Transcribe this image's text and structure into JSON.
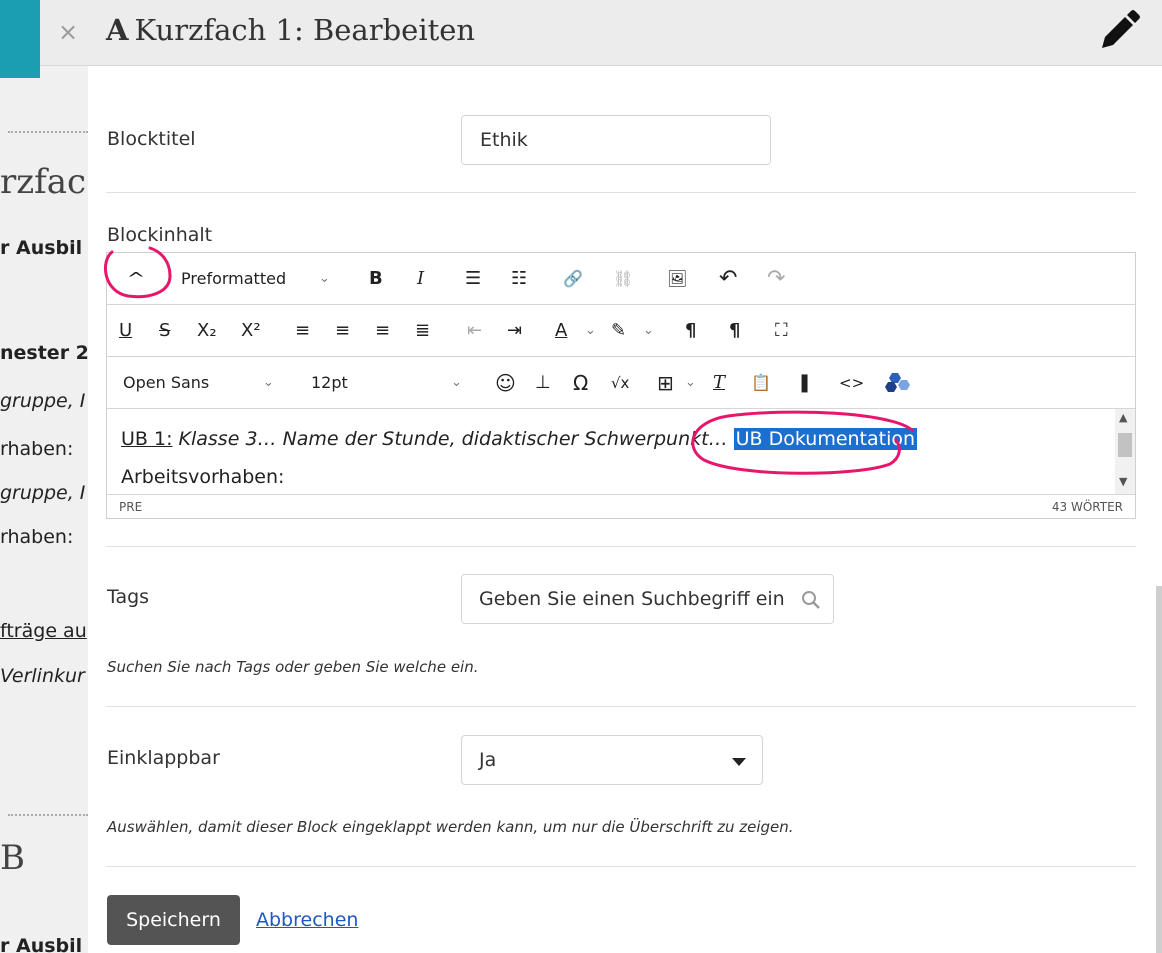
{
  "background": {
    "lines": [
      {
        "text": "rzfac",
        "kind": "big"
      },
      {
        "text": "r Ausbil",
        "kind": "bold"
      },
      {
        "text": "nester 2",
        "kind": "bold"
      },
      {
        "text": "gruppe, I",
        "kind": "italic"
      },
      {
        "text": "rhaben:",
        "kind": "normal"
      },
      {
        "text": "gruppe, I",
        "kind": "italic"
      },
      {
        "text": "rhaben:",
        "kind": "normal"
      },
      {
        "text": "fträge au",
        "kind": "underline"
      },
      {
        "text": "Verlinkur",
        "kind": "italic"
      },
      {
        "text": "B",
        "kind": "big"
      },
      {
        "text": "r Ausbil",
        "kind": "bold"
      }
    ]
  },
  "modal": {
    "close_glyph": "×",
    "title_icon": "A",
    "title": "Kurzfach 1: Bearbeiten"
  },
  "form": {
    "blocktitel": {
      "label": "Blocktitel",
      "value": "Ethik"
    },
    "blockinhalt": {
      "label": "Blockinhalt"
    },
    "tags": {
      "label": "Tags",
      "placeholder": "Geben Sie einen Suchbegriff ein",
      "hint": "Suchen Sie nach Tags oder geben Sie welche ein."
    },
    "einklappbar": {
      "label": "Einklappbar",
      "value": "Ja",
      "hint": "Auswählen, damit dieser Block eingeklappt werden kann, um nur die Überschrift zu zeigen."
    }
  },
  "editor": {
    "toolbar1": {
      "collapse": "^",
      "format": "Preformatted",
      "bold": "B",
      "italic": "I",
      "bullets": "☰",
      "numbers": "☷",
      "link": "🔗",
      "unlink": "⛓",
      "image": "🖼",
      "undo": "↶",
      "redo": "↷"
    },
    "toolbar2": {
      "underline": "U",
      "strike": "S",
      "subscript": "X₂",
      "superscript": "X²",
      "align_left": "≡",
      "align_center": "≡",
      "align_right": "≡",
      "justify": "≣",
      "outdent": "⇤",
      "indent": "⇥",
      "text_color": "A",
      "highlight": "✎",
      "ltr": "¶",
      "rtl": "¶",
      "fullscreen": "⛶"
    },
    "toolbar3": {
      "font": "Open Sans",
      "size": "12pt",
      "emoji": "☺",
      "anchor": "⊥",
      "omega": "Ω",
      "sqrt": "√x",
      "table": "⊞",
      "clear": "T",
      "paste": "📋",
      "bookmark": "❚",
      "code": "<>"
    },
    "content": {
      "ub_label": "UB 1:",
      "italic_text": "Klasse 3… Name der Stunde, didaktischer Schwerpunkt…",
      "highlight": "UB Dokumentation",
      "second_line": "Arbeitsvorhaben:"
    },
    "status": {
      "path": "PRE",
      "word_count": "43 WÖRTER"
    }
  },
  "actions": {
    "save": "Speichern",
    "cancel": "Abbrechen"
  },
  "colors": {
    "accent_teal": "#1a9fb0",
    "highlight_blue": "#1a6fd0",
    "annotation_red": "#e8166b",
    "save_button": "#545454",
    "link_blue": "#1f57c4"
  }
}
